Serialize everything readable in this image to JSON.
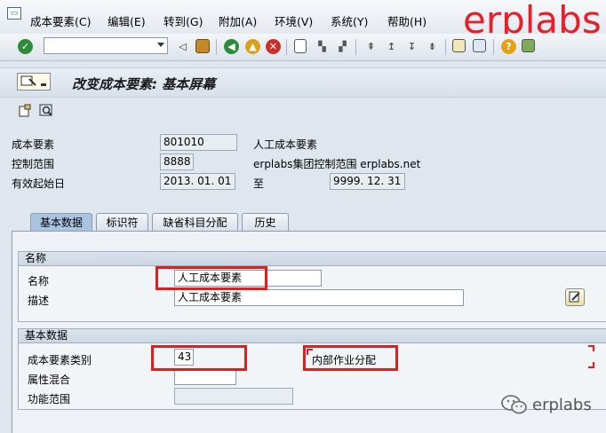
{
  "menu": {
    "items": [
      "成本要素(C)",
      "编辑(E)",
      "转到(G)",
      "附加(A)",
      "环境(V)",
      "系统(Y)",
      "帮助(H)"
    ]
  },
  "watermark": {
    "top": "erplabs",
    "bottom": "erplabs"
  },
  "toolbar": {
    "command_field": ""
  },
  "title": "改变成本要素: 基本屏幕",
  "header": {
    "cost_element_label": "成本要素",
    "cost_element_value": "801010",
    "cost_element_desc": "人工成本要素",
    "controlling_area_label": "控制范围",
    "controlling_area_value": "8888",
    "controlling_area_desc": "erplabs集团控制范围 erplabs.net",
    "valid_from_label": "有效起始日",
    "valid_from_value": "2013. 01. 01",
    "to_label": "至",
    "valid_to_value": "9999. 12. 31"
  },
  "tabs": [
    "基本数据",
    "标识符",
    "缺省科目分配",
    "历史"
  ],
  "names_group": {
    "title": "名称",
    "name_label": "名称",
    "name_value": "人工成本要素",
    "desc_label": "描述",
    "desc_value": "人工成本要素"
  },
  "basic_group": {
    "title": "基本数据",
    "category_label": "成本要素类别",
    "category_value": "43",
    "category_desc": "内部作业分配",
    "attr_label": "属性混合",
    "attr_value": "",
    "func_label": "功能范围",
    "func_value": ""
  },
  "colors": {
    "highlight": "#e01e1e",
    "watermark": "#e5202a",
    "active_tab": "#a9c4e0"
  }
}
